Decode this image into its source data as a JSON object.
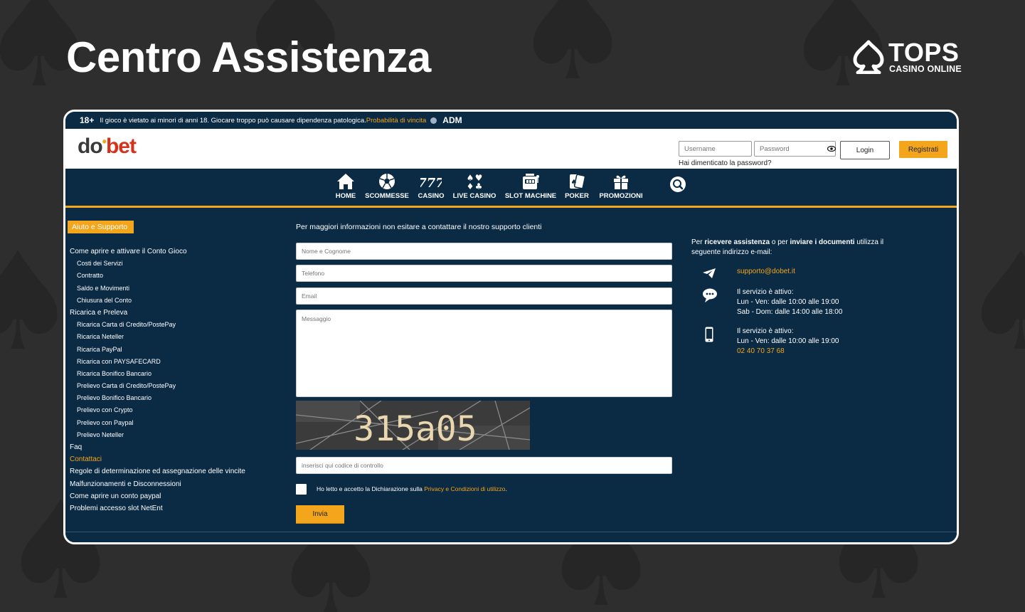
{
  "page_title": "Centro Assistenza",
  "brand": {
    "name": "TOPS",
    "subtitle": "CASINO ONLINE",
    "icon": "spade-icon"
  },
  "site": {
    "warning": {
      "age_badge": "18+",
      "text": "Il gioco è vietato ai minori di anni 18. Giocare troppo può causare dipendenza patologica.",
      "link": "Probabilità di vincita",
      "adm": "ADM"
    },
    "logo": {
      "part1": "do",
      "part2": "bet"
    },
    "header": {
      "username_placeholder": "Username",
      "password_placeholder": "Password",
      "login_label": "Login",
      "register_label": "Registrati",
      "forgot_label": "Hai dimenticato la password?"
    },
    "nav": [
      {
        "label": "HOME",
        "icon": "home-icon"
      },
      {
        "label": "SCOMMESSE",
        "icon": "soccer-ball-icon"
      },
      {
        "label": "CASINO",
        "icon": "777-icon"
      },
      {
        "label": "LIVE CASINO",
        "icon": "card-suits-icon"
      },
      {
        "label": "SLOT MACHINE",
        "icon": "slot-machine-icon"
      },
      {
        "label": "POKER",
        "icon": "playing-cards-icon"
      },
      {
        "label": "PROMOZIONI",
        "icon": "gift-icon"
      }
    ],
    "sidebar": {
      "title": "Aiuto e Supporto",
      "items": [
        {
          "label": "Come aprire e attivare il Conto Gioco",
          "level": "main"
        },
        {
          "label": "Costi dei Servizi",
          "level": "sub"
        },
        {
          "label": "Contratto",
          "level": "sub"
        },
        {
          "label": "Saldo e Movimenti",
          "level": "sub"
        },
        {
          "label": "Chiusura del Conto",
          "level": "sub"
        },
        {
          "label": "Ricarica e Preleva",
          "level": "main"
        },
        {
          "label": "Ricarica Carta di Credito/PostePay",
          "level": "sub"
        },
        {
          "label": "Ricarica Neteller",
          "level": "sub"
        },
        {
          "label": "Ricarica PayPal",
          "level": "sub"
        },
        {
          "label": "Ricarica con PAYSAFECARD",
          "level": "sub"
        },
        {
          "label": "Ricarica Bonifico Bancario",
          "level": "sub"
        },
        {
          "label": "Prelievo Carta di Credito/PostePay",
          "level": "sub"
        },
        {
          "label": "Prelievo Bonifico Bancario",
          "level": "sub"
        },
        {
          "label": "Prelievo con Crypto",
          "level": "sub"
        },
        {
          "label": "Prelievo con Paypal",
          "level": "sub"
        },
        {
          "label": "Prelievo Neteller",
          "level": "sub"
        },
        {
          "label": "Faq",
          "level": "main"
        },
        {
          "label": "Contattaci",
          "level": "main",
          "active": true
        },
        {
          "label": "Regole di determinazione ed assegnazione delle vincite",
          "level": "main"
        },
        {
          "label": "Malfunzionamenti e Disconnessioni",
          "level": "main"
        },
        {
          "label": "Come aprire un conto paypal",
          "level": "main"
        },
        {
          "label": "Problemi accesso slot NetEnt",
          "level": "main"
        }
      ]
    },
    "form": {
      "intro": "Per maggiori informazioni non esitare a contattare il nostro supporto clienti",
      "name_placeholder": "Nome e Cognome",
      "phone_placeholder": "Telefono",
      "email_placeholder": "Email",
      "message_placeholder": "Messaggio",
      "captcha_text": "315a05",
      "captcha_placeholder": "inserisci qui codice di controllo",
      "terms_text": "Ho letto e accetto la Dichiarazione sulla ",
      "terms_link": "Privacy e Condizioni di utilizzo",
      "terms_end": ".",
      "submit_label": "Invia"
    },
    "contact": {
      "intro_1": "Per ",
      "intro_bold_1": "ricevere assistenza",
      "intro_2": " o per ",
      "intro_bold_2": "inviare i documenti",
      "intro_3": " utilizza il seguente indirizzo e-mail:",
      "email": "supporto@dobet.it",
      "chat_title": "Il servizio è attivo:",
      "chat_hours_1": "Lun - Ven: dalle 10:00 alle 19:00",
      "chat_hours_2": "Sab - Dom: dalle 14:00 alle 18:00",
      "phone_title": "Il servizio è attivo:",
      "phone_hours": "Lun - Ven: dalle 10:00 alle 19:00",
      "phone_number": "02 40 70 37 68"
    }
  },
  "colors": {
    "accent": "#f3a51b",
    "site_bg": "#0b2a44",
    "page_bg": "#2e2e2e"
  }
}
